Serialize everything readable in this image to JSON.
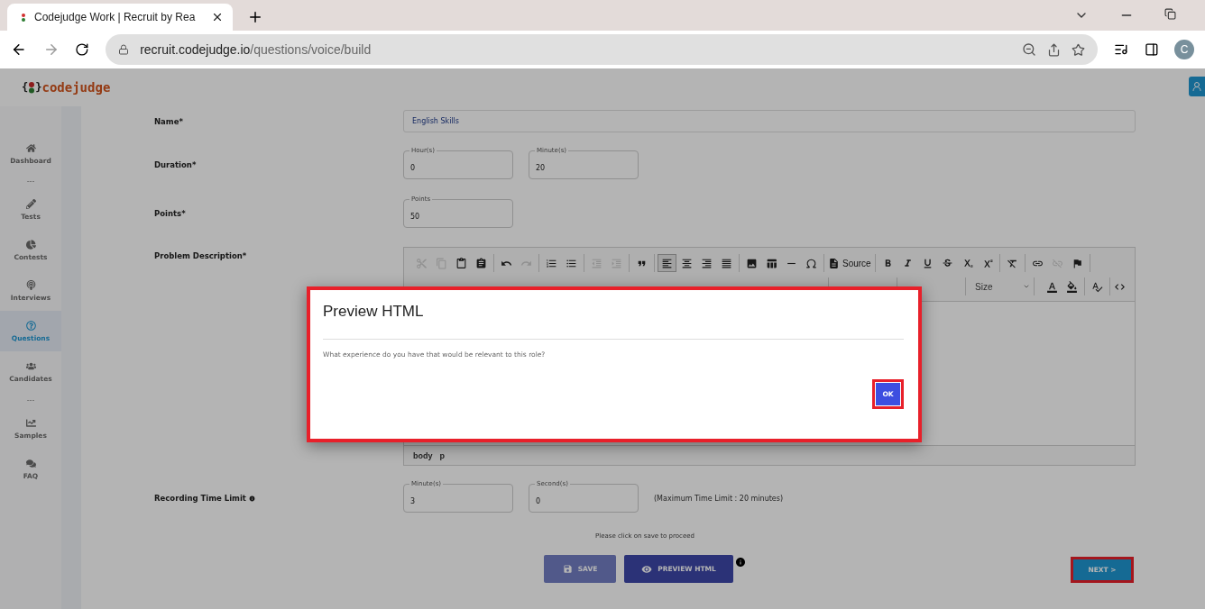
{
  "browser": {
    "tab_title": "Codejudge Work | Recruit by Rea",
    "url_domain": "recruit.codejudge.io",
    "url_path": "/questions/voice/build",
    "profile_initial": "C"
  },
  "logo": {
    "open": "{",
    "close": "}",
    "name": "codejudge"
  },
  "sidebar": {
    "items": [
      {
        "kind": "item",
        "label": "Dashboard",
        "selected": false
      },
      {
        "kind": "divider",
        "label": "---"
      },
      {
        "kind": "item",
        "label": "Tests",
        "selected": false
      },
      {
        "kind": "item",
        "label": "Contests",
        "selected": false
      },
      {
        "kind": "item",
        "label": "Interviews",
        "selected": false
      },
      {
        "kind": "item",
        "label": "Questions",
        "selected": true
      },
      {
        "kind": "item",
        "label": "Candidates",
        "selected": false
      },
      {
        "kind": "divider",
        "label": "---"
      },
      {
        "kind": "item",
        "label": "Samples",
        "selected": false
      },
      {
        "kind": "item",
        "label": "FAQ",
        "selected": false
      }
    ]
  },
  "form": {
    "name": {
      "label": "Name*",
      "value": "English Skills"
    },
    "duration": {
      "label": "Duration*",
      "fields": [
        {
          "label": "Hour(s)",
          "value": "0"
        },
        {
          "label": "Minute(s)",
          "value": "20"
        }
      ]
    },
    "points": {
      "label": "Points*",
      "fields": [
        {
          "label": "Points",
          "value": "50"
        }
      ]
    },
    "description": {
      "label": "Problem Description*"
    },
    "recording": {
      "label": "Recording Time Limit",
      "fields": [
        {
          "label": "Minute(s)",
          "value": "3"
        },
        {
          "label": "Second(s)",
          "value": "0"
        }
      ],
      "note": "(Maximum Time Limit : 20 minutes)"
    }
  },
  "editor": {
    "toolbar": [
      [
        {
          "disabled": true,
          "selected": false
        },
        {
          "disabled": true,
          "selected": false
        },
        {
          "disabled": false,
          "selected": false
        },
        {
          "disabled": false,
          "selected": false
        }
      ],
      [
        {
          "disabled": false,
          "selected": false
        },
        {
          "disabled": true,
          "selected": false
        }
      ],
      [
        {
          "disabled": false,
          "selected": false
        },
        {
          "disabled": false,
          "selected": false
        }
      ],
      [
        {
          "disabled": true,
          "selected": false
        },
        {
          "disabled": true,
          "selected": false
        }
      ],
      [
        {
          "disabled": false,
          "selected": false
        }
      ],
      [
        {
          "disabled": false,
          "selected": true
        },
        {
          "disabled": false,
          "selected": false
        },
        {
          "disabled": false,
          "selected": false
        },
        {
          "disabled": false,
          "selected": false
        }
      ],
      [
        {
          "disabled": false,
          "selected": false
        },
        {
          "disabled": false,
          "selected": false
        },
        {
          "disabled": false,
          "selected": false
        },
        {
          "disabled": false,
          "selected": false
        }
      ],
      [
        {
          "disabled": false,
          "selected": false,
          "label": "Source"
        }
      ],
      [
        {
          "disabled": false,
          "selected": false
        },
        {
          "disabled": false,
          "selected": false
        },
        {
          "disabled": false,
          "selected": false
        },
        {
          "disabled": false,
          "selected": false
        },
        {
          "disabled": false,
          "selected": false
        },
        {
          "disabled": false,
          "selected": false
        }
      ],
      [
        {
          "disabled": false,
          "selected": false
        }
      ],
      [
        {
          "disabled": false,
          "selected": false
        },
        {
          "disabled": true,
          "selected": false
        },
        {
          "disabled": false,
          "selected": false
        }
      ]
    ],
    "dropdowns": [
      "Size"
    ],
    "path": [
      "body",
      "p"
    ]
  },
  "save_hint": "Please click on save to proceed",
  "buttons": {
    "save": "SAVE",
    "preview": "PREVIEW HTML",
    "next": "NEXT >"
  },
  "modal": {
    "title": "Preview HTML",
    "text": "What experience do you have that would be relevant to this role?",
    "ok": "OK"
  }
}
